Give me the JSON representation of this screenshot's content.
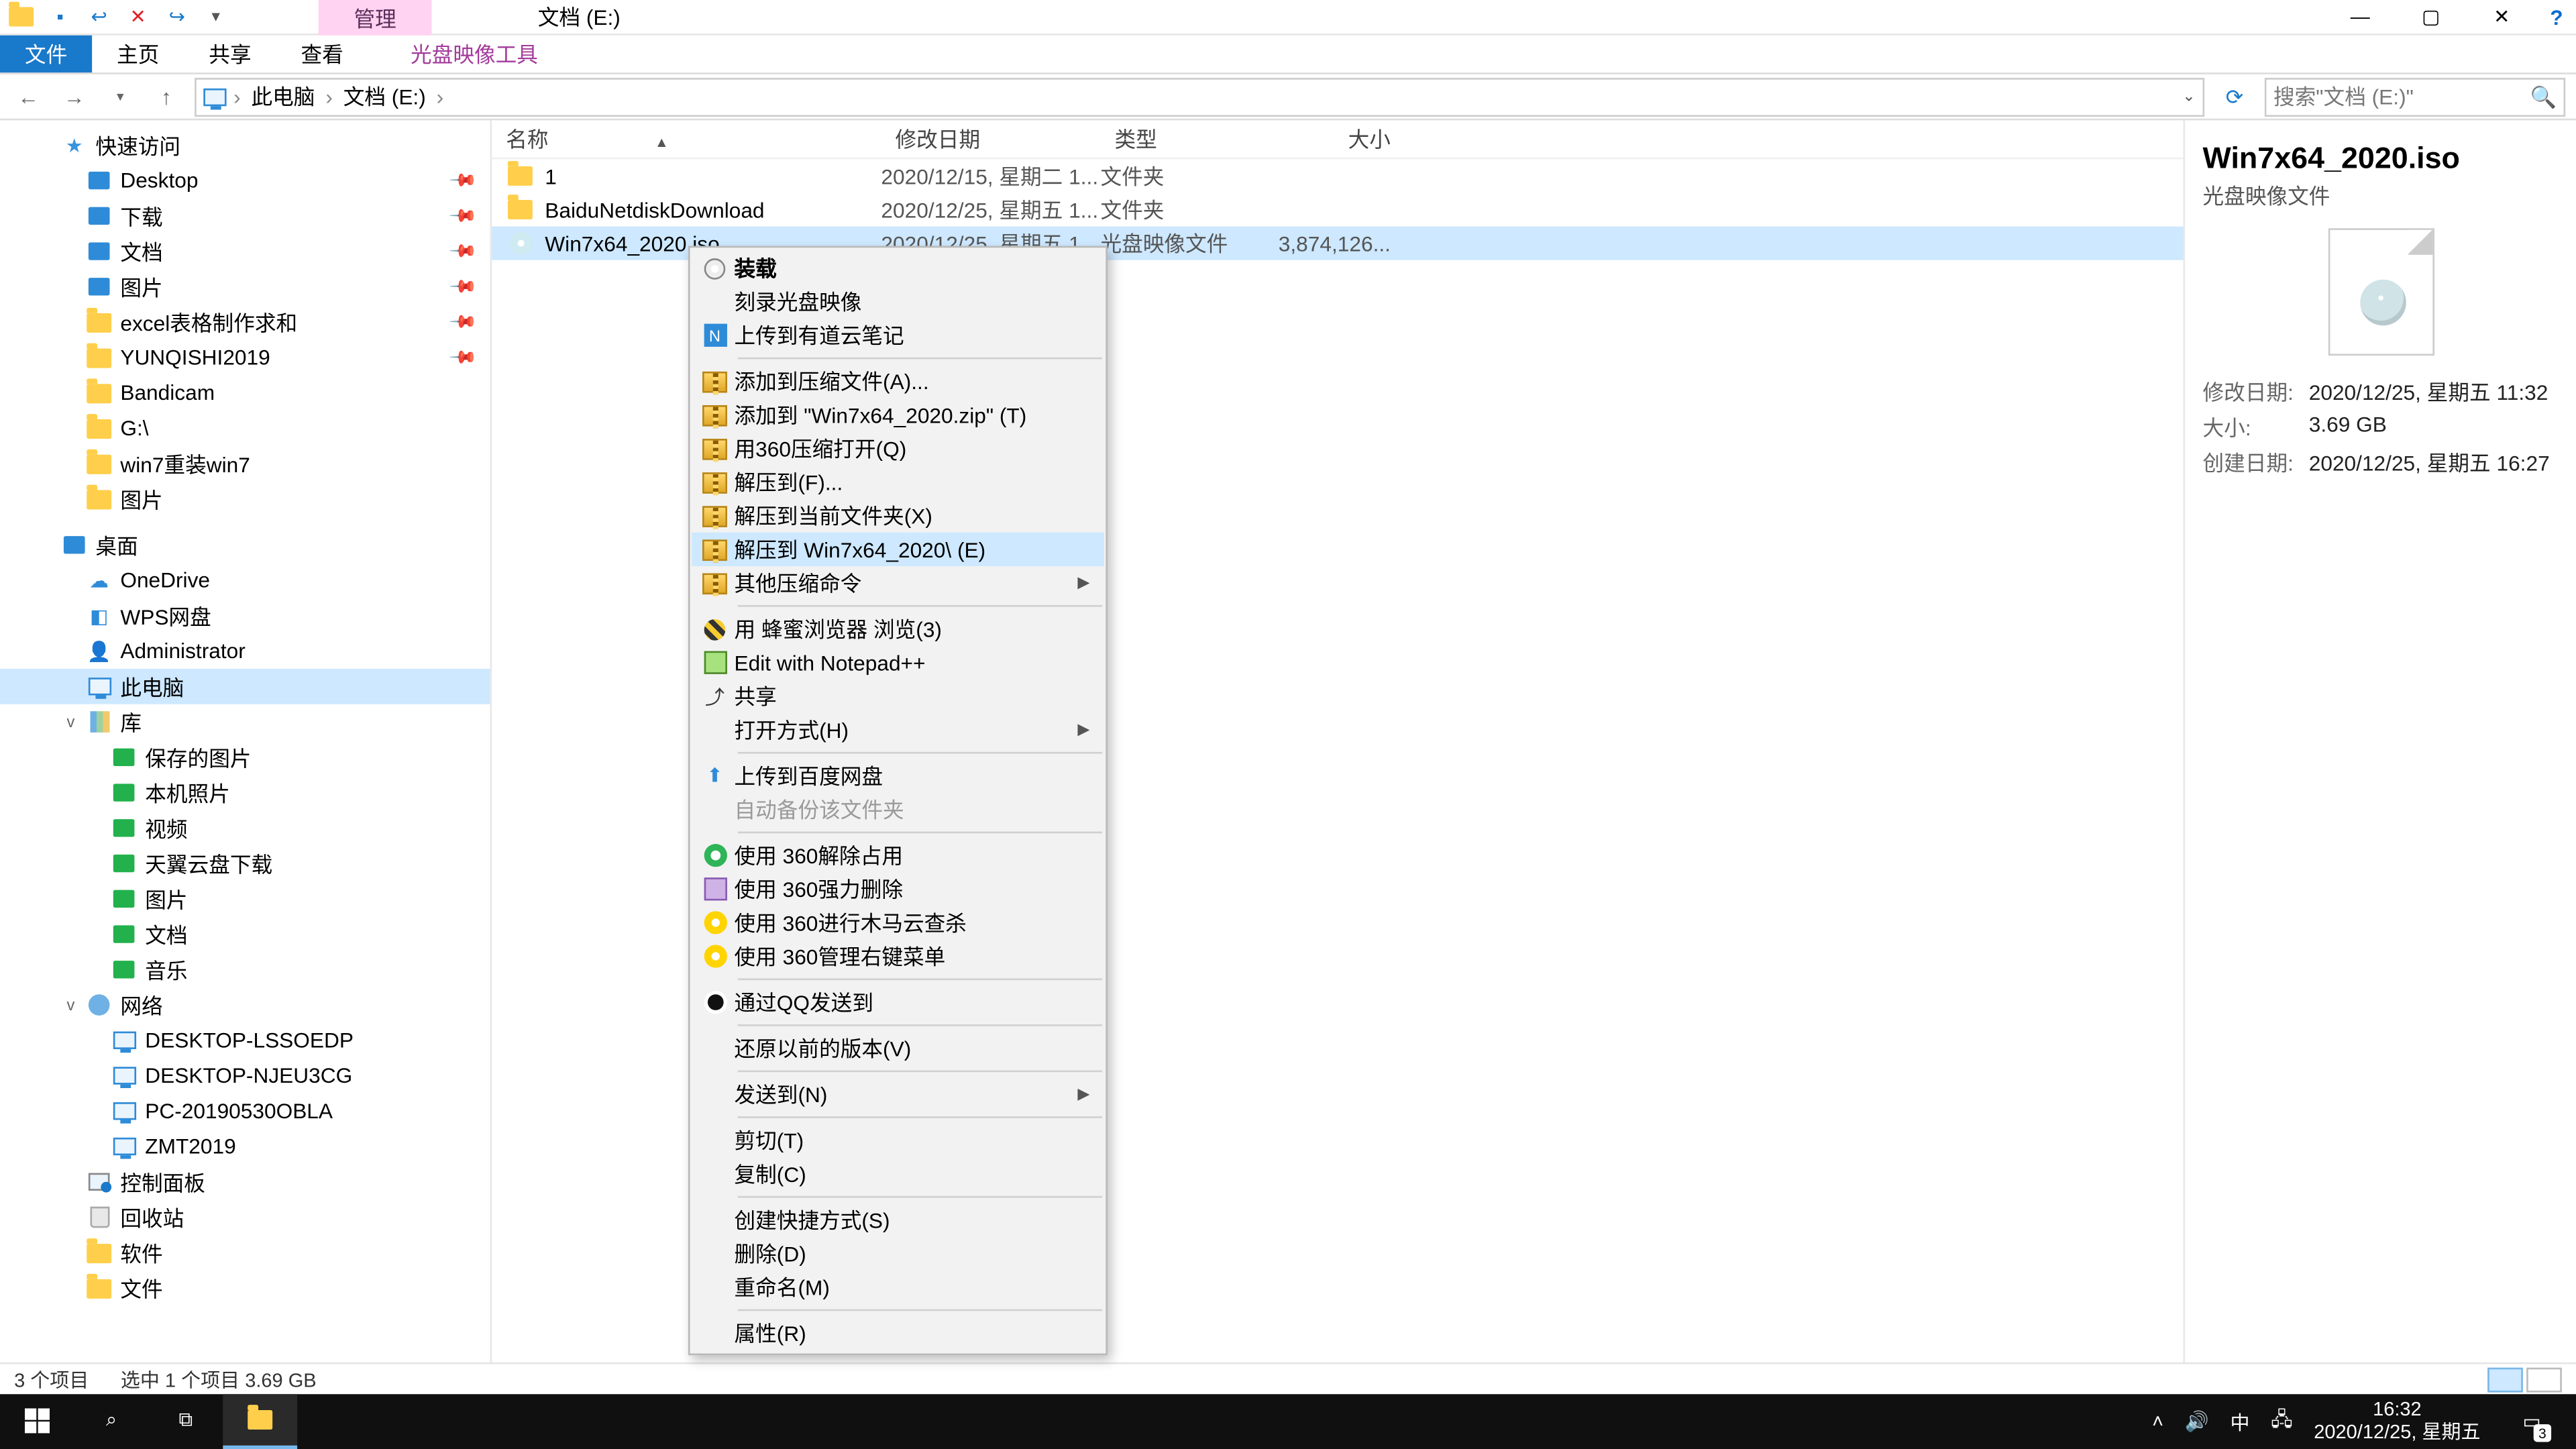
{
  "title": "文档 (E:)",
  "context_tab": "管理",
  "qat": {
    "save_icon": "save",
    "undo_icon": "undo",
    "delete_icon": "✕",
    "redo_icon": "redo"
  },
  "win": {
    "min": "—",
    "max": "▢",
    "close": "✕",
    "help": "?"
  },
  "ribbon": {
    "file": "文件",
    "home": "主页",
    "share": "共享",
    "view": "查看",
    "ctx": "光盘映像工具"
  },
  "nav": {
    "back": "←",
    "fwd": "→",
    "up": "↑"
  },
  "crumbs": [
    "此电脑",
    "文档 (E:)"
  ],
  "refresh_icon": "⟳",
  "search": {
    "placeholder": "搜索\"文档 (E:)\"",
    "mag": "🔍"
  },
  "tree": {
    "quick": {
      "label": "快速访问",
      "items": [
        {
          "label": "Desktop",
          "pin": true,
          "ind": 2,
          "ic": "blue"
        },
        {
          "label": "下载",
          "pin": true,
          "ind": 2,
          "ic": "blue"
        },
        {
          "label": "文档",
          "pin": true,
          "ind": 2,
          "ic": "blue"
        },
        {
          "label": "图片",
          "pin": true,
          "ind": 2,
          "ic": "blue"
        },
        {
          "label": "excel表格制作求和",
          "pin": true,
          "ind": 2,
          "ic": "folder"
        },
        {
          "label": "YUNQISHI2019",
          "pin": true,
          "ind": 2,
          "ic": "folder"
        },
        {
          "label": "Bandicam",
          "pin": false,
          "ind": 2,
          "ic": "folder"
        },
        {
          "label": "G:\\",
          "pin": false,
          "ind": 2,
          "ic": "folder"
        },
        {
          "label": "win7重装win7",
          "pin": false,
          "ind": 2,
          "ic": "folder"
        },
        {
          "label": "图片",
          "pin": false,
          "ind": 2,
          "ic": "folder"
        }
      ]
    },
    "desktop": {
      "label": "桌面",
      "items": [
        {
          "label": "OneDrive",
          "ind": 2,
          "ic": "cloud"
        },
        {
          "label": "WPS网盘",
          "ind": 2,
          "ic": "wps"
        },
        {
          "label": "Administrator",
          "ind": 2,
          "ic": "user"
        },
        {
          "label": "此电脑",
          "ind": 2,
          "ic": "mon",
          "sel": true
        },
        {
          "label": "库",
          "ind": 2,
          "ic": "lib",
          "exp": "v"
        },
        {
          "label": "保存的图片",
          "ind": 3,
          "ic": "green"
        },
        {
          "label": "本机照片",
          "ind": 3,
          "ic": "green"
        },
        {
          "label": "视频",
          "ind": 3,
          "ic": "green"
        },
        {
          "label": "天翼云盘下载",
          "ind": 3,
          "ic": "green"
        },
        {
          "label": "图片",
          "ind": 3,
          "ic": "green"
        },
        {
          "label": "文档",
          "ind": 3,
          "ic": "green"
        },
        {
          "label": "音乐",
          "ind": 3,
          "ic": "green"
        },
        {
          "label": "网络",
          "ind": 2,
          "ic": "net",
          "exp": "v"
        },
        {
          "label": "DESKTOP-LSSOEDP",
          "ind": 3,
          "ic": "mon"
        },
        {
          "label": "DESKTOP-NJEU3CG",
          "ind": 3,
          "ic": "mon"
        },
        {
          "label": "PC-20190530OBLA",
          "ind": 3,
          "ic": "mon"
        },
        {
          "label": "ZMT2019",
          "ind": 3,
          "ic": "mon"
        },
        {
          "label": "控制面板",
          "ind": 2,
          "ic": "cp"
        },
        {
          "label": "回收站",
          "ind": 2,
          "ic": "bin"
        },
        {
          "label": "软件",
          "ind": 2,
          "ic": "folder"
        },
        {
          "label": "文件",
          "ind": 2,
          "ic": "folder"
        }
      ]
    }
  },
  "cols": {
    "name": "名称",
    "mod": "修改日期",
    "type": "类型",
    "size": "大小"
  },
  "rows": [
    {
      "name": "1",
      "mod": "2020/12/15, 星期二 1...",
      "type": "文件夹",
      "size": "",
      "ic": "folder"
    },
    {
      "name": "BaiduNetdiskDownload",
      "mod": "2020/12/25, 星期五 1...",
      "type": "文件夹",
      "size": "",
      "ic": "folder"
    },
    {
      "name": "Win7x64_2020.iso",
      "mod": "2020/12/25, 星期五 1...",
      "type": "光盘映像文件",
      "size": "3,874,126...",
      "ic": "disc",
      "sel": true
    }
  ],
  "ctxmenu": [
    {
      "label": "装载",
      "ic": "mount",
      "bold": true
    },
    {
      "label": "刻录光盘映像"
    },
    {
      "label": "上传到有道云笔记",
      "ic": "note"
    },
    {
      "sep": true
    },
    {
      "label": "添加到压缩文件(A)...",
      "ic": "archive"
    },
    {
      "label": "添加到 \"Win7x64_2020.zip\" (T)",
      "ic": "archive"
    },
    {
      "label": "用360压缩打开(Q)",
      "ic": "archive"
    },
    {
      "label": "解压到(F)...",
      "ic": "archive"
    },
    {
      "label": "解压到当前文件夹(X)",
      "ic": "archive"
    },
    {
      "label": "解压到 Win7x64_2020\\ (E)",
      "ic": "archive",
      "hov": true
    },
    {
      "label": "其他压缩命令",
      "ic": "archive",
      "sub": true
    },
    {
      "sep": true
    },
    {
      "label": "用 蜂蜜浏览器 浏览(3)",
      "ic": "bee"
    },
    {
      "label": "Edit with Notepad++",
      "ic": "npp"
    },
    {
      "label": "共享",
      "ic": "share"
    },
    {
      "label": "打开方式(H)",
      "sub": true
    },
    {
      "sep": true
    },
    {
      "label": "上传到百度网盘",
      "ic": "baidu"
    },
    {
      "label": "自动备份该文件夹",
      "dis": true
    },
    {
      "sep": true
    },
    {
      "label": "使用 360解除占用",
      "ic": "360"
    },
    {
      "label": "使用 360强力删除",
      "ic": "force"
    },
    {
      "label": "使用 360进行木马云查杀",
      "ic": "360y"
    },
    {
      "label": "使用 360管理右键菜单",
      "ic": "360y"
    },
    {
      "sep": true
    },
    {
      "label": "通过QQ发送到",
      "ic": "qq"
    },
    {
      "sep": true
    },
    {
      "label": "还原以前的版本(V)"
    },
    {
      "sep": true
    },
    {
      "label": "发送到(N)",
      "sub": true
    },
    {
      "sep": true
    },
    {
      "label": "剪切(T)"
    },
    {
      "label": "复制(C)"
    },
    {
      "sep": true
    },
    {
      "label": "创建快捷方式(S)"
    },
    {
      "label": "删除(D)"
    },
    {
      "label": "重命名(M)"
    },
    {
      "sep": true
    },
    {
      "label": "属性(R)"
    }
  ],
  "detail": {
    "name": "Win7x64_2020.iso",
    "type": "光盘映像文件",
    "rows": [
      {
        "k": "修改日期:",
        "v": "2020/12/25, 星期五 11:32"
      },
      {
        "k": "大小:",
        "v": "3.69 GB"
      },
      {
        "k": "创建日期:",
        "v": "2020/12/25, 星期五 16:27"
      }
    ]
  },
  "status": {
    "count": "3 个项目",
    "sel": "选中 1 个项目  3.69 GB"
  },
  "taskbar": {
    "tray": {
      "ime": "中",
      "time": "16:32",
      "date": "2020/12/25, 星期五",
      "notif_count": "3"
    }
  }
}
